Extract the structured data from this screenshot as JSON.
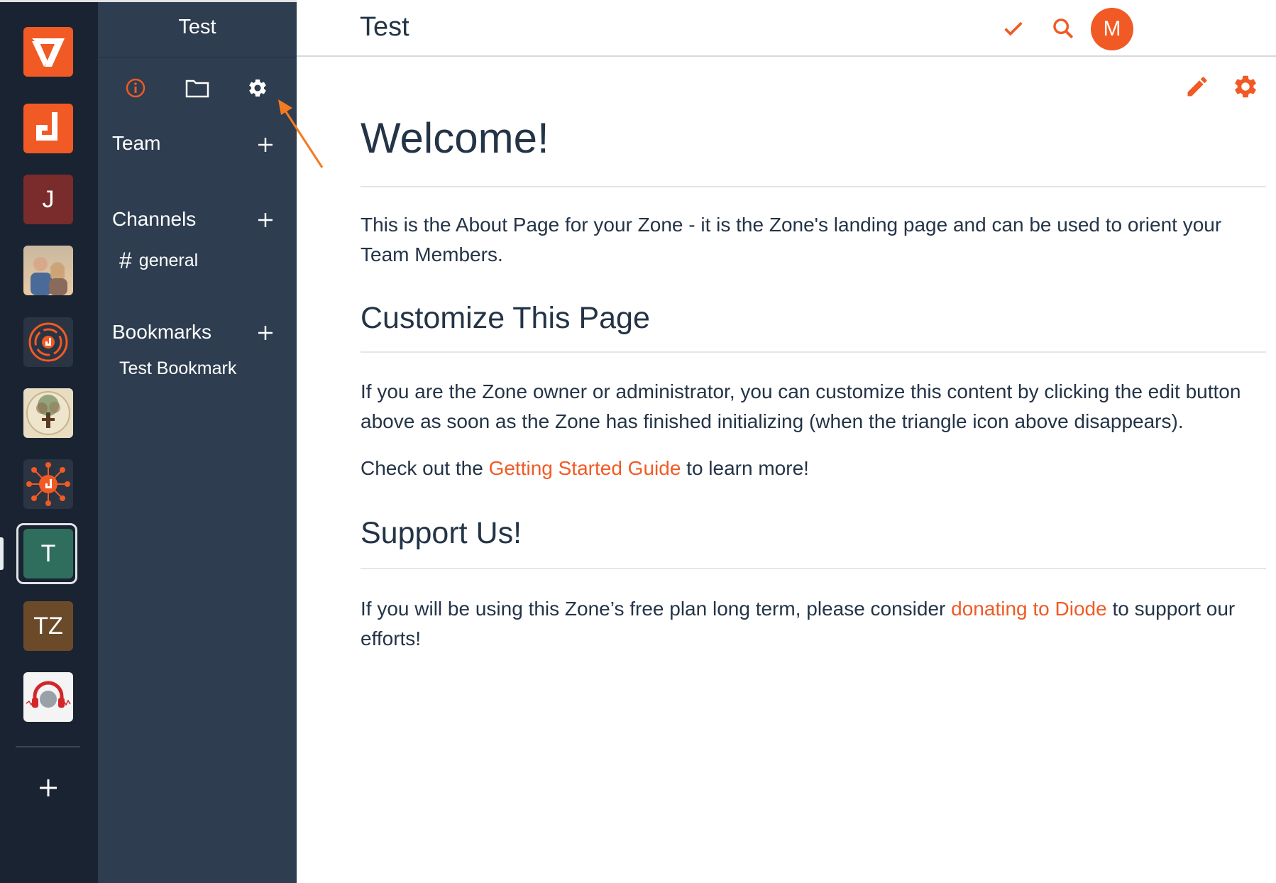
{
  "zones": [
    {
      "name": "Diode zone logo",
      "icon": "diode-v-logo"
    },
    {
      "name": "Diode zone",
      "icon": "diode-d-logo"
    },
    {
      "name": "J",
      "letter": "J",
      "color": "#7a2b2b"
    },
    {
      "name": "Family photo zone",
      "icon": "photo-avatar"
    },
    {
      "name": "Diode circle zone",
      "icon": "diode-circle-logo"
    },
    {
      "name": "Tree zone",
      "icon": "tree-logo"
    },
    {
      "name": "Diode network zone",
      "icon": "diode-network-logo"
    },
    {
      "name": "T",
      "letter": "T",
      "color": "#2f6e5c",
      "active": true
    },
    {
      "name": "TZ",
      "letter": "TZ",
      "color": "#6b4a2a"
    },
    {
      "name": "Headphones zone",
      "icon": "headphones-logo"
    }
  ],
  "sidebar": {
    "zone_name": "Test",
    "tabs": [
      "info-icon",
      "folder-icon",
      "settings-icon"
    ],
    "sections": {
      "team": {
        "title": "Team"
      },
      "channels": {
        "title": "Channels",
        "items": [
          {
            "hash": "#",
            "label": "general"
          }
        ]
      },
      "bookmarks": {
        "title": "Bookmarks",
        "items": [
          {
            "label": "Test Bookmark"
          }
        ]
      }
    }
  },
  "topbar": {
    "title": "Test",
    "avatar_initial": "M"
  },
  "content": {
    "welcome_heading": "Welcome!",
    "intro": "This is the About Page for your Zone - it is the Zone's landing page and can be used to orient your Team Members.",
    "customize_heading": "Customize This Page",
    "customize_text": "If you are the Zone owner or administrator, you can customize this content by clicking the edit button above as soon as the Zone has finished initializing (when the triangle icon above disappears).",
    "checkout_prefix": "Check out the ",
    "checkout_link": "Getting Started Guide",
    "checkout_suffix": " to learn more!",
    "support_heading": "Support Us!",
    "support_prefix": "If you will be using this Zone’s free plan long term, please consider ",
    "support_link": "donating to Diode",
    "support_suffix": " to support our efforts!"
  },
  "colors": {
    "accent": "#f15a24",
    "rail_bg": "#1a2331",
    "sidebar_bg": "#2e3d50",
    "text_dark": "#243447"
  }
}
